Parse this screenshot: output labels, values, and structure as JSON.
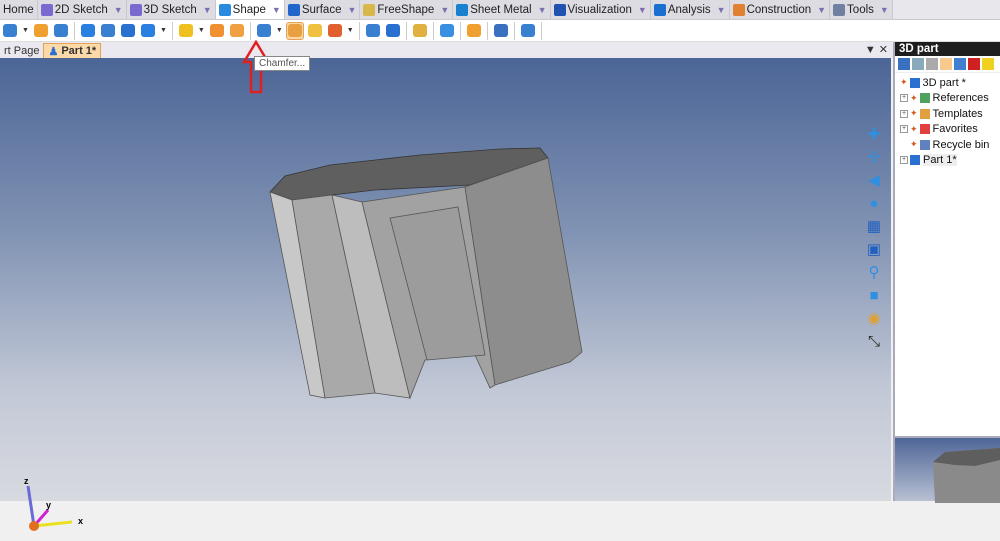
{
  "ribbon": {
    "tabs": [
      {
        "label": "Home",
        "icon": "home-icon",
        "color": "#dcdce2"
      },
      {
        "label": "2D Sketch",
        "icon": "pencil-icon",
        "color": "#7a6ad0"
      },
      {
        "label": "3D Sketch",
        "icon": "pencil-icon",
        "color": "#7a6ad0"
      },
      {
        "label": "Shape",
        "icon": "cube-icon",
        "color": "#2a8ae0",
        "active": true
      },
      {
        "label": "Surface",
        "icon": "surface-icon",
        "color": "#2266cc"
      },
      {
        "label": "FreeShape",
        "icon": "freeshape-icon",
        "color": "#d8b848"
      },
      {
        "label": "Sheet Metal",
        "icon": "sheet-metal-icon",
        "color": "#1a80d0"
      },
      {
        "label": "Visualization",
        "icon": "monitor-icon",
        "color": "#2050b0"
      },
      {
        "label": "Analysis",
        "icon": "analysis-icon",
        "color": "#1a70d0"
      },
      {
        "label": "Construction",
        "icon": "wand-icon",
        "color": "#e08030"
      },
      {
        "label": "Tools",
        "icon": "tools-icon",
        "color": "#7080a0"
      }
    ]
  },
  "toolbar": {
    "tooltip": "Chamfer...",
    "accent_arrow": "#e02020"
  },
  "doc_tabs": [
    {
      "label": "rt Page"
    },
    {
      "label": "Part 1*",
      "active": true
    }
  ],
  "panel": {
    "title": "3D part",
    "tree": [
      {
        "label": "3D part *",
        "expander": false,
        "icon": "part-icon"
      },
      {
        "label": "References",
        "expander": true,
        "icon": "references-icon"
      },
      {
        "label": "Templates",
        "expander": true,
        "icon": "templates-icon"
      },
      {
        "label": "Favorites",
        "expander": true,
        "icon": "favorites-icon"
      },
      {
        "label": "Recycle bin",
        "expander": false,
        "icon": "recycle-bin-icon"
      },
      {
        "label": "Part 1*",
        "expander": true,
        "icon": "part-icon"
      }
    ]
  },
  "axes": {
    "x": "x",
    "y": "y",
    "z": "z"
  }
}
